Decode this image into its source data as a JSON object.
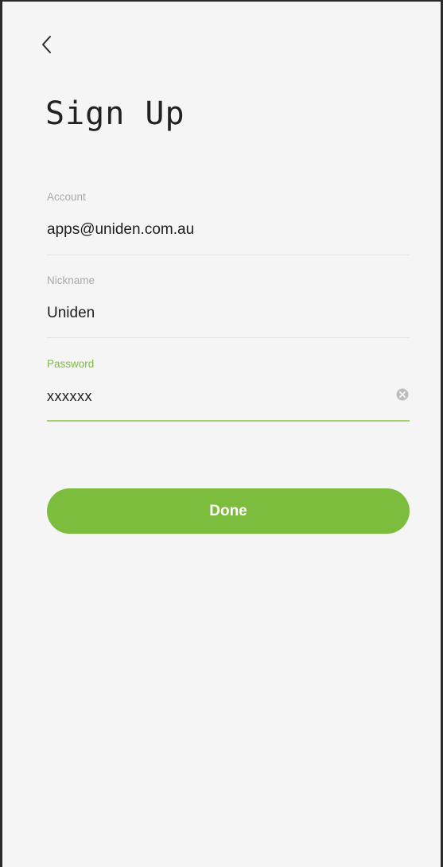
{
  "header": {
    "title": "Sign Up",
    "back_icon": "chevron-left-icon"
  },
  "form": {
    "account": {
      "label": "Account",
      "value": "apps@uniden.com.au"
    },
    "nickname": {
      "label": "Nickname",
      "value": "Uniden"
    },
    "password": {
      "label": "Password",
      "value": "xxxxxx",
      "clear_icon": "clear-icon"
    }
  },
  "actions": {
    "done_label": "Done"
  },
  "colors": {
    "accent": "#7cbd3d",
    "background": "#f5f5f5",
    "label": "#a9a9a9",
    "text": "#1d1d1d"
  }
}
